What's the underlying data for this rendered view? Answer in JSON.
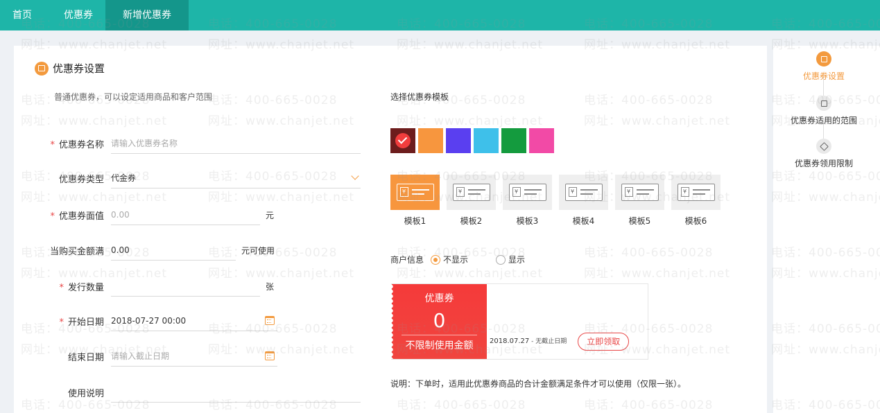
{
  "nav": {
    "tabs": [
      {
        "label": "首页"
      },
      {
        "label": "优惠券"
      },
      {
        "label": "新增优惠券"
      }
    ]
  },
  "watermark": {
    "phone": "电话：400-665-0028",
    "site": "网址：www.chanjet.net"
  },
  "form": {
    "section_title": "优惠券设置",
    "description": "普通优惠券，可以设定适用商品和客户范围",
    "name": {
      "label": "优惠券名称",
      "placeholder": "请输入优惠券名称"
    },
    "type": {
      "label": "优惠券类型",
      "value": "代金券"
    },
    "face_value": {
      "label": "优惠券面值",
      "placeholder": "0.00",
      "unit": "元"
    },
    "threshold": {
      "label": "当购买金额满",
      "value": "0.00",
      "unit": "元可使用"
    },
    "quantity": {
      "label": "发行数量",
      "value": "",
      "unit": "张"
    },
    "start_date": {
      "label": "开始日期",
      "value": "2018-07-27 00:00"
    },
    "end_date": {
      "label": "结束日期",
      "placeholder": "请输入截止日期"
    },
    "usage": {
      "label": "使用说明"
    }
  },
  "template": {
    "title": "选择优惠券模板",
    "colors": [
      "#6d1d1d",
      "#f7963e",
      "#5a3ff0",
      "#3ec0ea",
      "#149b3e",
      "#f24aa6"
    ],
    "templates": [
      {
        "name": "模板1",
        "active": true
      },
      {
        "name": "模板2"
      },
      {
        "name": "模板3"
      },
      {
        "name": "模板4"
      },
      {
        "name": "模板5"
      },
      {
        "name": "模板6"
      }
    ],
    "merchant_label": "商户信息",
    "merchant_options": [
      {
        "label": "不显示",
        "selected": true
      },
      {
        "label": "显示",
        "selected": false
      }
    ]
  },
  "preview": {
    "title": "优惠券",
    "amount": "0",
    "condition": "不限制使用金额",
    "date": "2018.07.27",
    "date_suffix": " - 无截止日期",
    "claim_button": "立即领取"
  },
  "note": "说明：下单时，适用此优惠券商品的合计金额满足条件才可以使用（仅限一张）。",
  "steps": [
    {
      "label": "优惠券设置",
      "active": true
    },
    {
      "label": "优惠券适用的范围"
    },
    {
      "label": "优惠券领用限制"
    }
  ]
}
